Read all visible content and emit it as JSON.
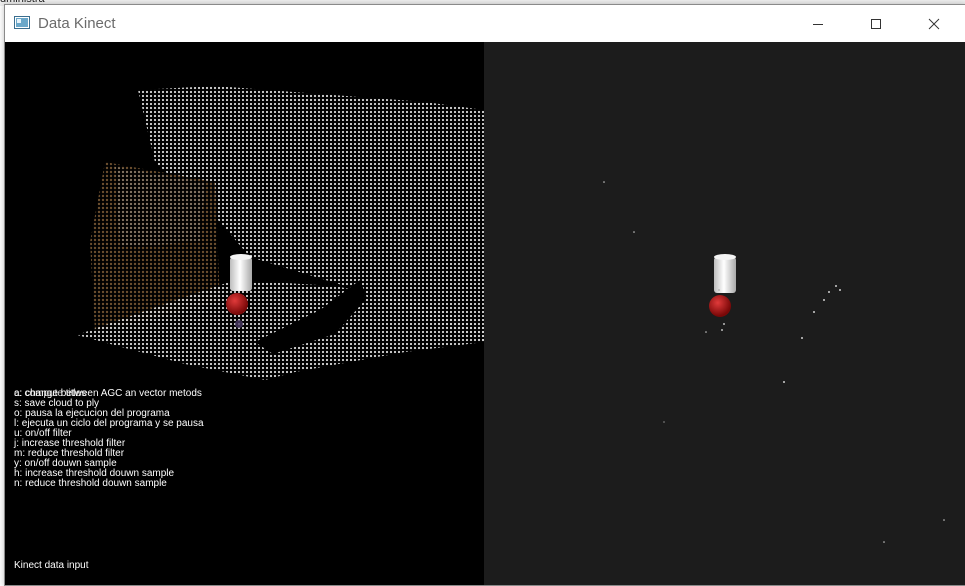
{
  "background": {
    "partial_text": "dministra"
  },
  "window": {
    "title": "Data Kinect",
    "controls": {
      "minimize_icon": "minimize-icon",
      "maximize_icon": "maximize-icon",
      "close_icon": "close-icon"
    }
  },
  "left_view": {
    "help_lines": [
      "a: change between AGC an vector metods",
      "s: save cloud to ply",
      "o: pausa la ejecucion del programa",
      "l: ejecuta un ciclo del programa y se pausa",
      "u: on/off filter",
      "j: increase threshold filter",
      "m: reduce  threshold filter",
      "y: on/off douwn sample",
      "h: increase threshold douwn sample",
      "n: reduce  threshold douwn sample"
    ],
    "help_overlap": "c: compute titles",
    "status": "Kinect data input"
  },
  "colors": {
    "left_bg": "#000000",
    "right_bg": "#1c1c1c",
    "points": "#d8d8d8",
    "cylinder": "#e8e8e8",
    "sphere": "#b01010"
  }
}
